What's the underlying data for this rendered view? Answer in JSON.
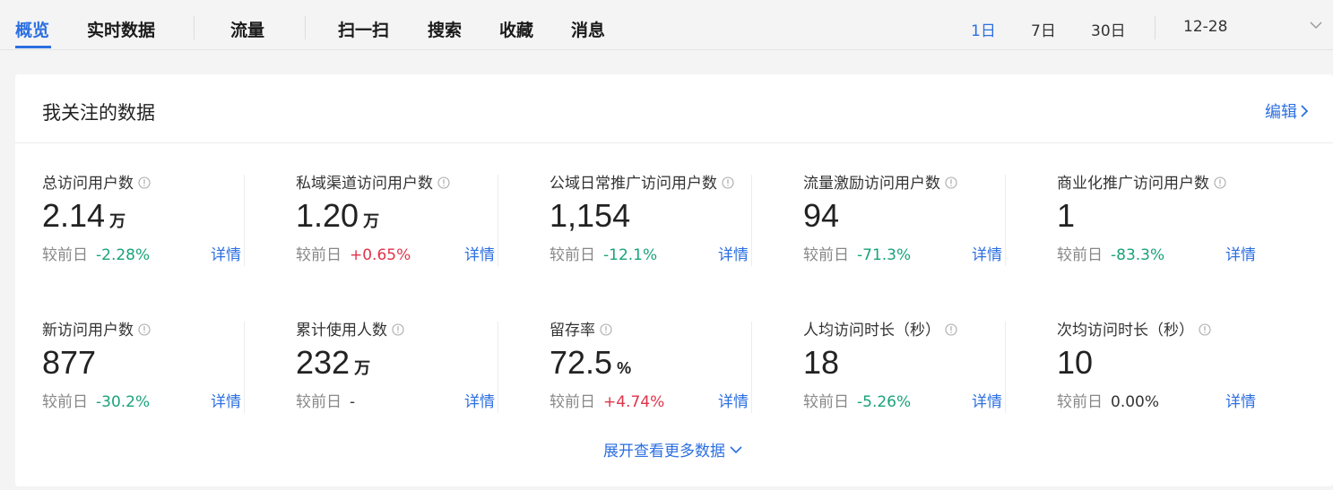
{
  "nav": {
    "tabs": [
      {
        "label": "概览",
        "active": true
      },
      {
        "label": "实时数据"
      },
      {
        "label": "流量"
      },
      {
        "label": "扫一扫"
      },
      {
        "label": "搜索"
      },
      {
        "label": "收藏"
      },
      {
        "label": "消息"
      }
    ],
    "ranges": [
      "1日",
      "7日",
      "30日"
    ],
    "active_range": "1日",
    "date_value": "12-28",
    "accent": "#2c6fe0"
  },
  "card": {
    "title": "我关注的数据",
    "edit_label": "编辑",
    "compare_label": "较前日",
    "detail_label": "详情",
    "expand_label": "展开查看更多数据",
    "metrics": [
      {
        "label": "总访问用户数",
        "value": "2.14",
        "unit": "万",
        "change": "-2.28%",
        "trend": "down"
      },
      {
        "label": "私域渠道访问用户数",
        "value": "1.20",
        "unit": "万",
        "change": "+0.65%",
        "trend": "up"
      },
      {
        "label": "公域日常推广访问用户数",
        "value": "1,154",
        "unit": "",
        "change": "-12.1%",
        "trend": "down"
      },
      {
        "label": "流量激励访问用户数",
        "value": "94",
        "unit": "",
        "change": "-71.3%",
        "trend": "down"
      },
      {
        "label": "商业化推广访问用户数",
        "value": "1",
        "unit": "",
        "change": "-83.3%",
        "trend": "down"
      },
      {
        "label": "新访问用户数",
        "value": "877",
        "unit": "",
        "change": "-30.2%",
        "trend": "down"
      },
      {
        "label": "累计使用人数",
        "value": "232",
        "unit": "万",
        "change": "-",
        "trend": "flat"
      },
      {
        "label": "留存率",
        "value": "72.5",
        "unit": "%",
        "change": "+4.74%",
        "trend": "up"
      },
      {
        "label": "人均访问时长（秒）",
        "value": "18",
        "unit": "",
        "change": "-5.26%",
        "trend": "down"
      },
      {
        "label": "次均访问时长（秒）",
        "value": "10",
        "unit": "",
        "change": "0.00%",
        "trend": "flat"
      }
    ],
    "colors": {
      "up": "#e0334a",
      "down": "#1aa37a"
    }
  }
}
